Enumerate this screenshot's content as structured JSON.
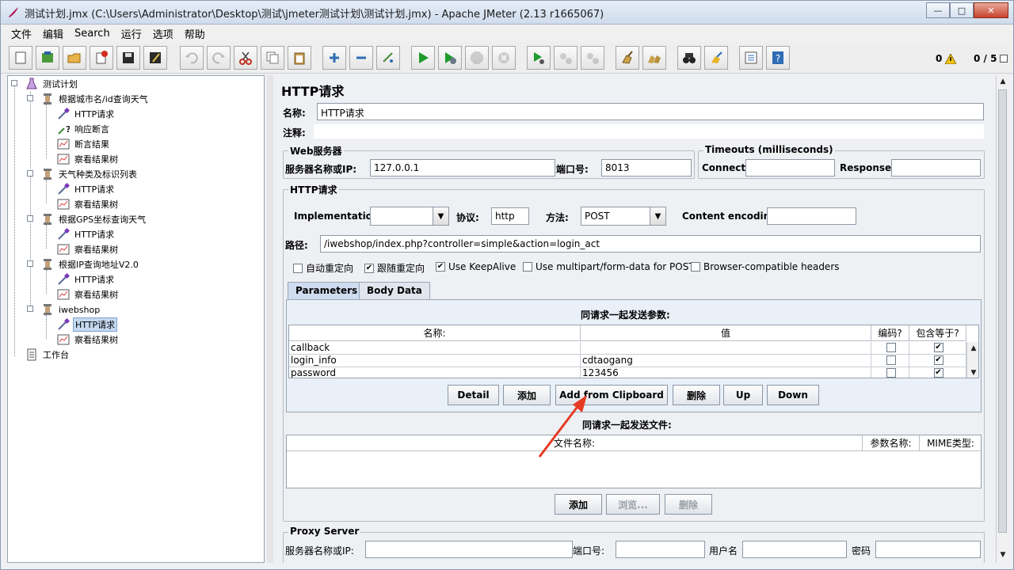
{
  "window": {
    "title": "测试计划.jmx (C:\\Users\\Administrator\\Desktop\\测试\\jmeter测试计划\\测试计划.jmx) - Apache JMeter (2.13 r1665067)",
    "btn_min": "—",
    "btn_max": "□",
    "btn_close": "✕"
  },
  "menu": [
    "文件",
    "编辑",
    "Search",
    "运行",
    "选项",
    "帮助"
  ],
  "toolbar": {
    "warning_count": "0",
    "thread_counts": "0 / 5"
  },
  "tree": {
    "root": "测试计划",
    "group1": "根据城市名/id查询天气",
    "g1_http": "HTTP请求",
    "g1_assert": "响应断言",
    "g1_assert_result": "断言结果",
    "g1_view": "察看结果树",
    "group2": "天气种类及标识列表",
    "g2_http": "HTTP请求",
    "g2_view": "察看结果树",
    "group3": "根据GPS坐标查询天气",
    "g3_http": "HTTP请求",
    "g3_view": "察看结果树",
    "group4": "根据IP查询地址V2.0",
    "g4_http": "HTTP请求",
    "g4_view": "察看结果树",
    "group5": "iwebshop",
    "g5_http": "HTTP请求",
    "g5_view": "察看结果树",
    "workbench": "工作台"
  },
  "form": {
    "heading": "HTTP请求",
    "name_label": "名称:",
    "name_value": "HTTP请求",
    "comment_label": "注释:",
    "web_server_title": "Web服务器",
    "server_label": "服务器名称或IP:",
    "server_value": "127.0.0.1",
    "port_label": "端口号:",
    "port_value": "8013",
    "timeouts_title": "Timeouts (milliseconds)",
    "connect_label": "Connect:",
    "response_label": "Response:",
    "http_title": "HTTP请求",
    "impl_label": "Implementation:",
    "impl_value": "",
    "protocol_label": "协议:",
    "protocol_value": "http",
    "method_label": "方法:",
    "method_value": "POST",
    "encoding_label": "Content encoding:",
    "path_label": "路径:",
    "path_value": "/iwebshop/index.php?controller=simple&action=login_act",
    "cb_redirect": "自动重定向",
    "cb_follow": "跟随重定向",
    "cb_keepalive": "Use KeepAlive",
    "cb_multipart": "Use multipart/form-data for POST",
    "cb_browser": "Browser-compatible headers",
    "tab_params": "Parameters",
    "tab_body": "Body Data",
    "params_caption": "同请求一起发送参数:",
    "col_name": "名称:",
    "col_value": "值",
    "col_encode": "编码?",
    "col_include": "包含等于?",
    "params": [
      {
        "name": "callback",
        "value": ""
      },
      {
        "name": "login_info",
        "value": "cdtaogang"
      },
      {
        "name": "password",
        "value": "123456"
      }
    ],
    "btn_detail": "Detail",
    "btn_add": "添加",
    "btn_clipboard": "Add from Clipboard",
    "btn_delete": "删除",
    "btn_up": "Up",
    "btn_down": "Down",
    "files_caption": "同请求一起发送文件:",
    "col_filename": "文件名称:",
    "col_paramname": "参数名称:",
    "col_mime": "MIME类型:",
    "btn_file_add": "添加",
    "btn_browse": "浏览...",
    "btn_file_delete": "删除",
    "proxy_title": "Proxy Server",
    "proxy_server_label": "服务器名称或IP:",
    "proxy_port_label": "端口号:",
    "proxy_user_label": "用户名",
    "proxy_pass_label": "密码"
  },
  "colors": {
    "accent": "#3a6ea5",
    "annotation_arrow": "#e53a24"
  }
}
